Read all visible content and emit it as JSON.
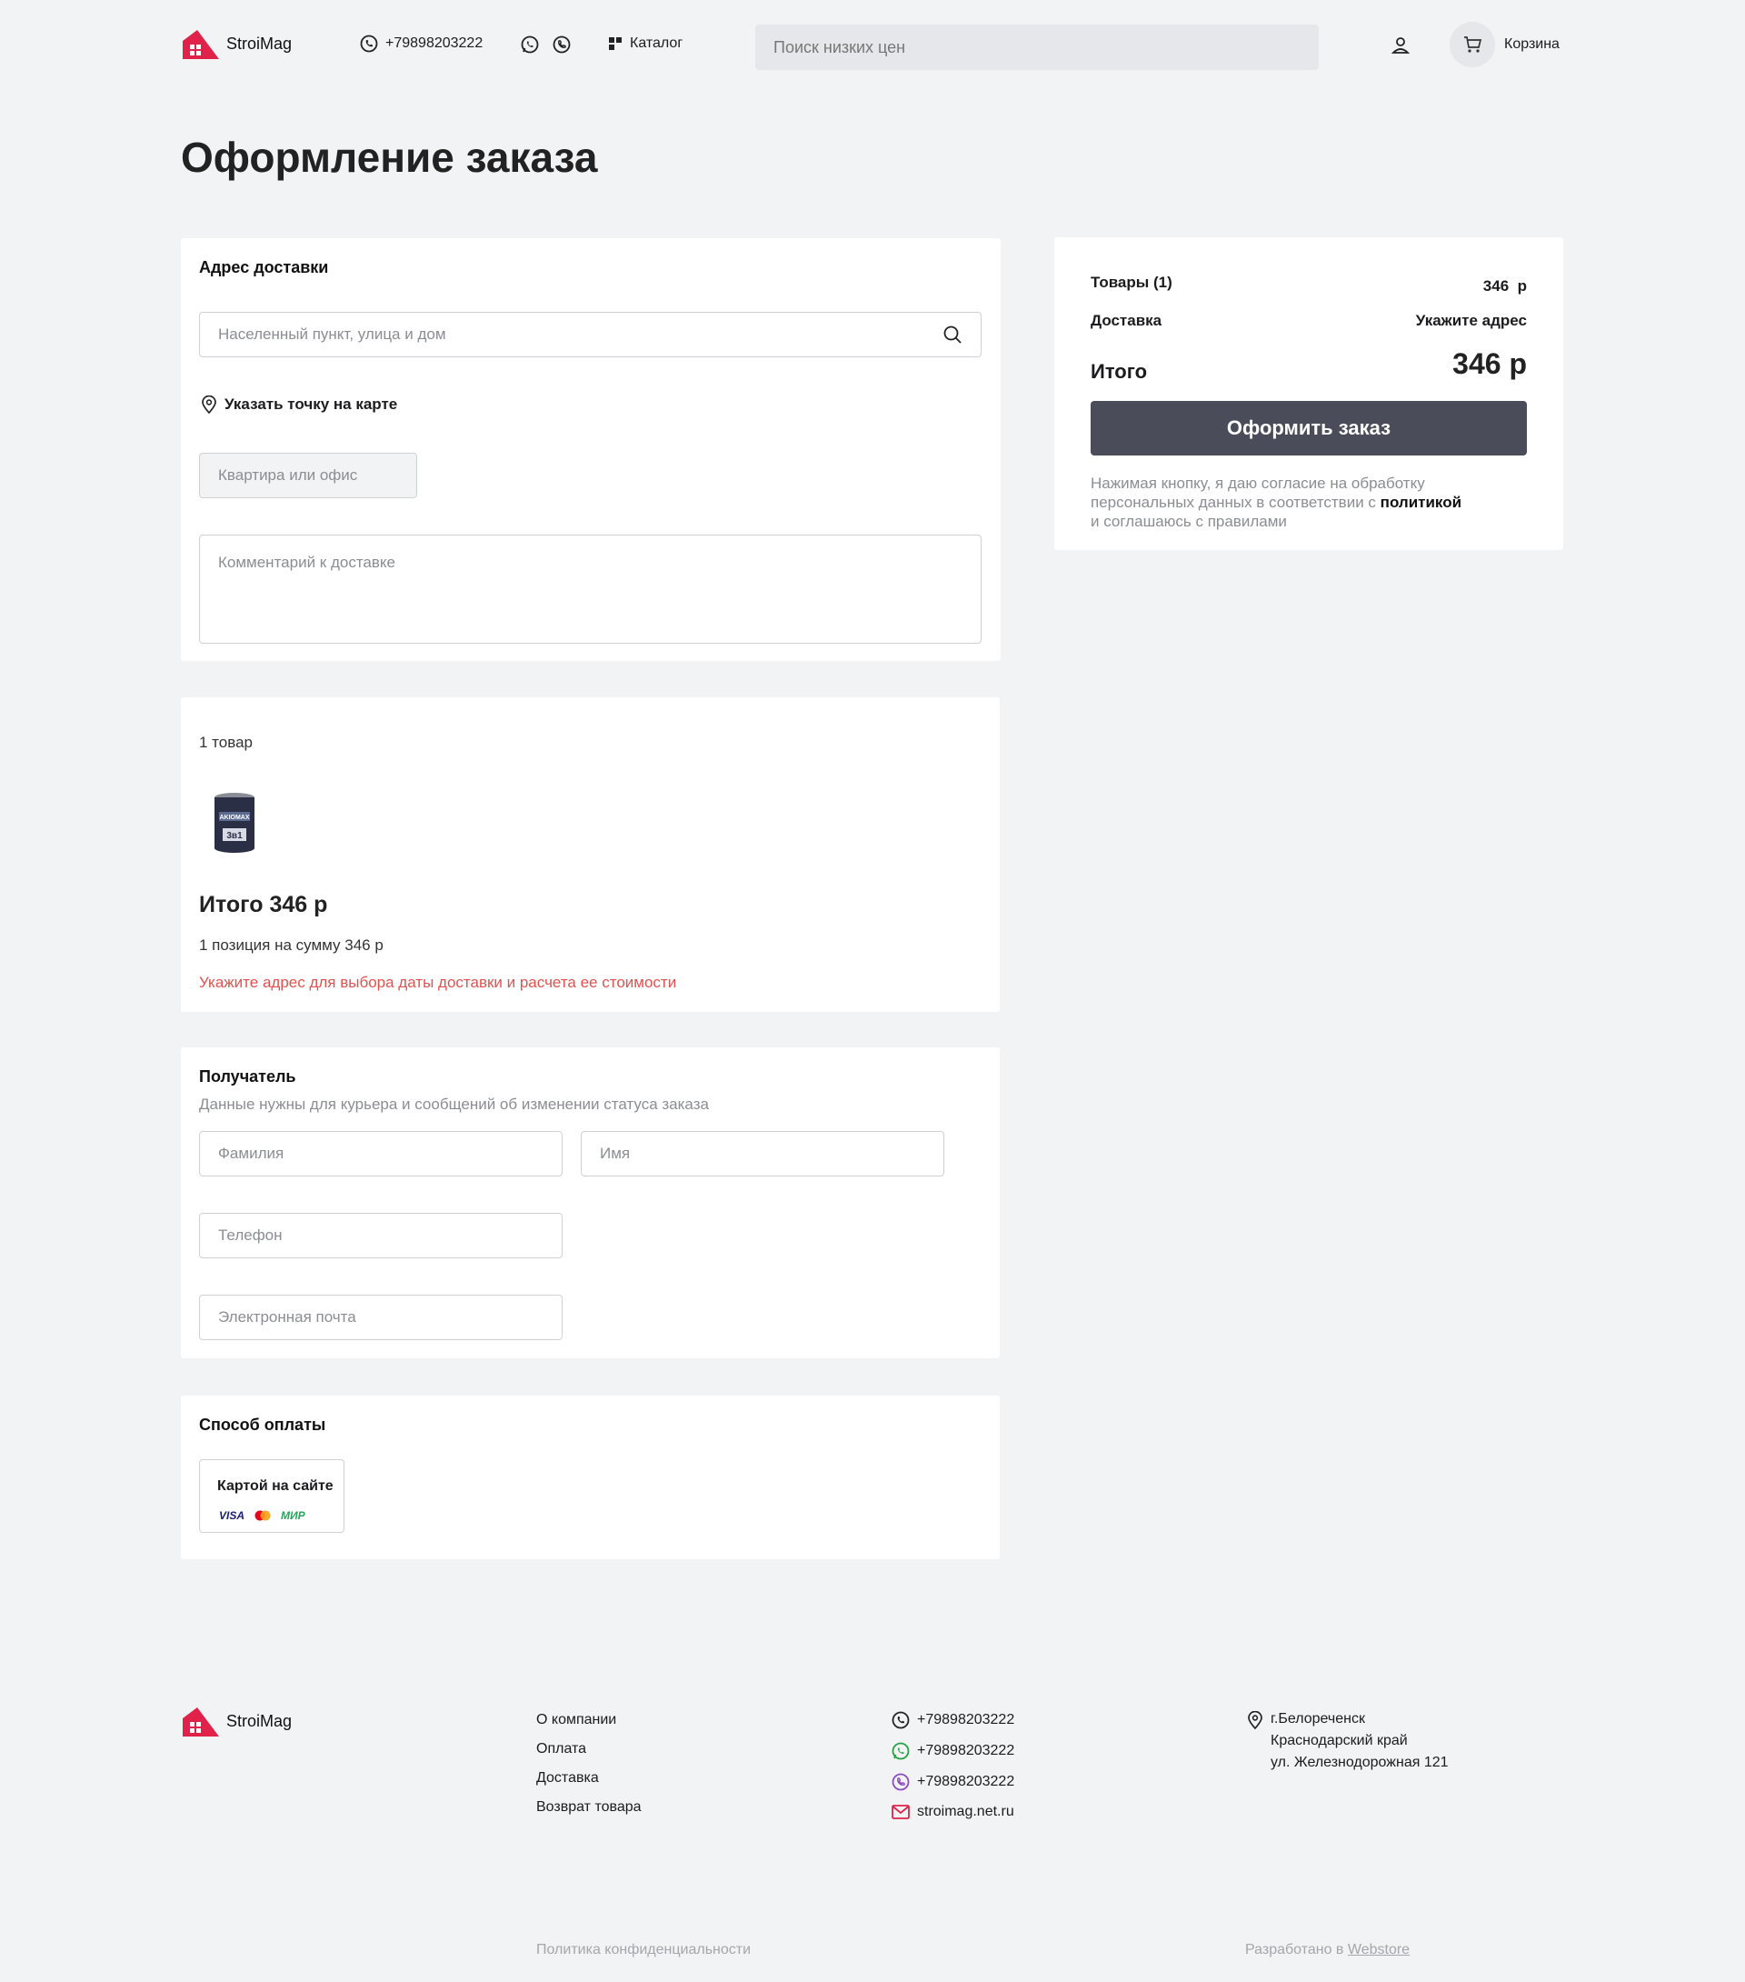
{
  "header": {
    "logo_text": "StroiMag",
    "phone": "+79898203222",
    "catalog_label": "Каталог",
    "search_placeholder": "Поиск низких цен",
    "cart_label": "Корзина"
  },
  "page_title": "Оформление заказа",
  "delivery": {
    "title": "Адрес доставки",
    "address_placeholder": "Населенный пункт, улица и дом",
    "map_link": "Указать точку на карте",
    "apartment_placeholder": "Квартира или офис",
    "comment_placeholder": "Комментарий к доставке"
  },
  "items": {
    "count_label": "1 товар",
    "total_label": "Итого 346 р",
    "positions_label": "1 позиция на сумму 346 р",
    "warning": "Укажите адрес для выбора даты доставки и расчета ее стоимости",
    "product_image": {
      "brand": "AKIOMAX",
      "badge": "3в1"
    }
  },
  "recipient": {
    "title": "Получатель",
    "subtitle": "Данные нужны для курьера и сообщений об изменении статуса заказа",
    "lastname_placeholder": "Фамилия",
    "firstname_placeholder": "Имя",
    "phone_placeholder": "Телефон",
    "email_placeholder": "Электронная почта"
  },
  "payment": {
    "title": "Способ оплаты",
    "option_label": "Картой на сайте",
    "logos": [
      "VISA",
      "MasterCard",
      "МИР"
    ]
  },
  "summary": {
    "goods_label": "Товары (1)",
    "goods_value": "346  р",
    "delivery_label": "Доставка",
    "delivery_value": "Укажите адрес",
    "total_label": "Итого",
    "total_value": "346 р",
    "order_button": "Оформить заказ",
    "consent_part1": "Нажимая кнопку, я даю согласие на обработку персональных данных в соответствии с",
    "consent_link": "политикой",
    "consent_part2": "и соглашаюсь с правилами"
  },
  "footer": {
    "logo_text": "StroiMag",
    "links": [
      "О компании",
      "Оплата",
      "Доставка",
      "Возврат товара"
    ],
    "contacts": {
      "phone": "+79898203222",
      "whatsapp": "+79898203222",
      "viber": "+79898203222",
      "email": "stroimag.net.ru"
    },
    "address_lines": [
      "г.Белореченск",
      "Краснодарский край",
      "ул. Железнодорожная 121"
    ],
    "privacy": "Политика конфиденциальности",
    "developed_prefix": "Разработано в",
    "developed_link": "Webstore"
  },
  "colors": {
    "brand_red": "#e0224a",
    "button_dark": "#4a4c5a",
    "warning_red": "#e0524f",
    "whatsapp_green": "#25a244",
    "viber_purple": "#8b4bc4"
  }
}
